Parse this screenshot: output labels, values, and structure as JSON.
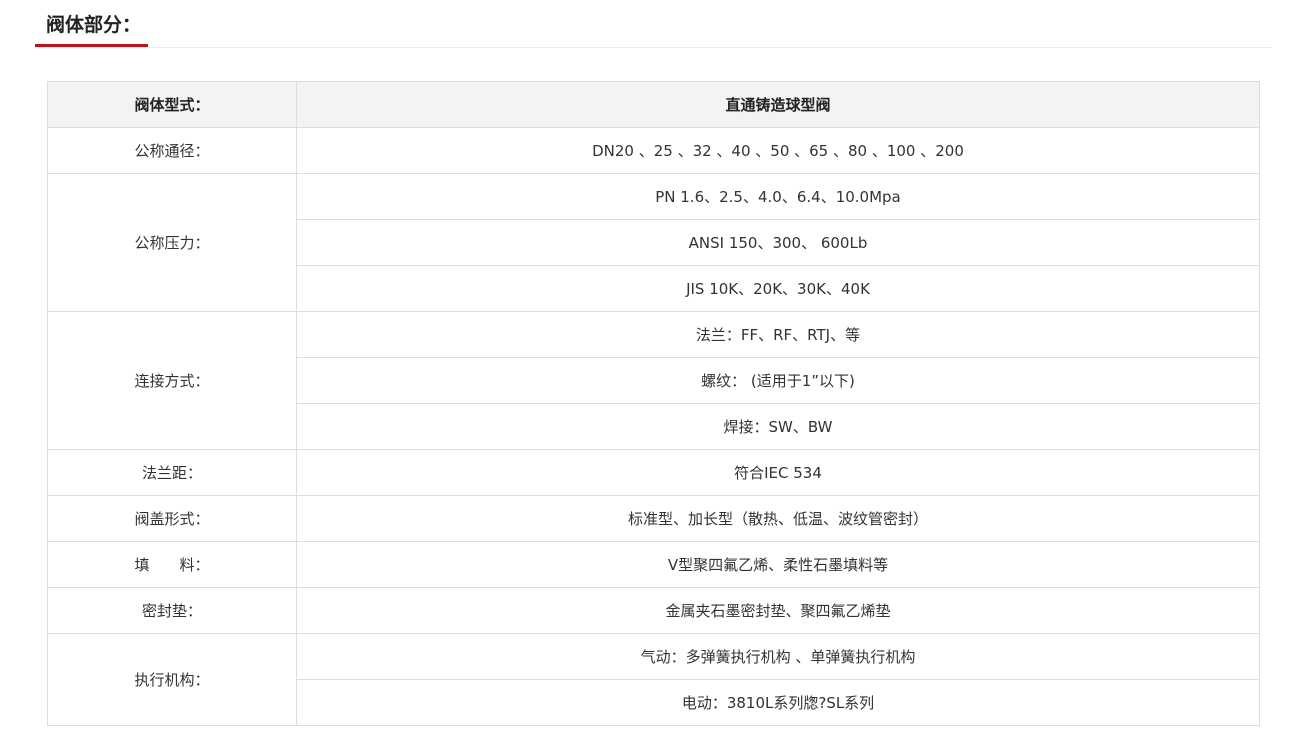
{
  "section": {
    "title": "阀体部分："
  },
  "table": {
    "header": {
      "label": "阀体型式：",
      "value": "直通铸造球型阀"
    },
    "rows": [
      {
        "label": "公称通径：",
        "values": [
          "DN20 、25 、32 、40 、50 、65 、80 、100 、200"
        ]
      },
      {
        "label": "公称压力：",
        "values": [
          "PN 1.6、2.5、4.0、6.4、10.0Mpa",
          "ANSI 150、300、 600Lb",
          "JIS 10K、20K、30K、40K"
        ]
      },
      {
        "label": "连接方式：",
        "values": [
          "法兰：FF、RF、RTJ、等",
          "螺纹： (适用于1”以下)",
          "焊接：SW、BW"
        ]
      },
      {
        "label": "法兰距：",
        "values": [
          "符合IEC 534"
        ]
      },
      {
        "label": "阀盖形式：",
        "values": [
          "标准型、加长型（散热、低温、波纹管密封）"
        ]
      },
      {
        "label": "填　　料：",
        "values": [
          "V型聚四氟乙烯、柔性石墨填料等"
        ]
      },
      {
        "label": "密封垫：",
        "values": [
          "金属夹石墨密封垫、聚四氟乙烯垫"
        ]
      },
      {
        "label": "执行机构：",
        "values": [
          "气动：多弹簧执行机构 、单弹簧执行机构",
          "电动：3810L系列牎?SL系列"
        ]
      }
    ]
  }
}
